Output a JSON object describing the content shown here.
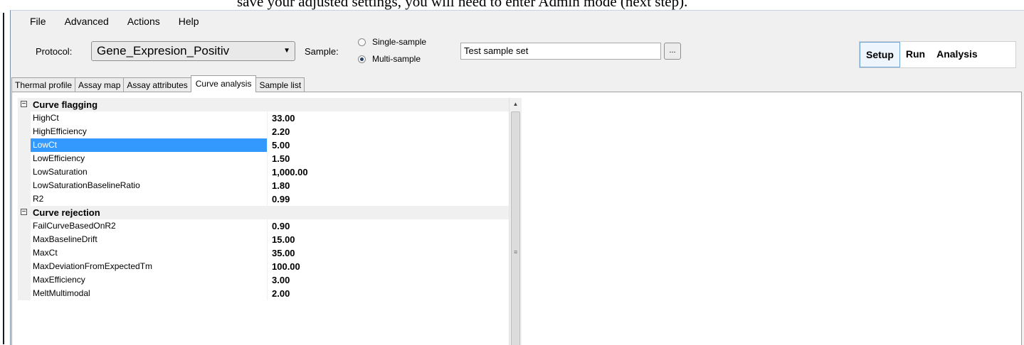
{
  "document_text": "save your adjusted settings, you will need to enter Admin mode (next step).",
  "menu": [
    "File",
    "Advanced",
    "Actions",
    "Help"
  ],
  "toolbar": {
    "protocol_label": "Protocol:",
    "protocol_value": "Gene_Expresion_Positiv",
    "sample_label": "Sample:",
    "sample_options": [
      "Single-sample",
      "Multi-sample"
    ],
    "sample_selected": "Multi-sample",
    "sample_set_value": "Test sample set",
    "browse_label": "..."
  },
  "modes": [
    "Setup",
    "Run",
    "Analysis"
  ],
  "active_mode": "Setup",
  "tabs": [
    "Thermal profile",
    "Assay map",
    "Assay attributes",
    "Curve analysis",
    "Sample list"
  ],
  "active_tab": "Curve analysis",
  "property_grid": {
    "sections": [
      {
        "name": "Curve flagging",
        "expander": "−",
        "properties": [
          {
            "name": "HighCt",
            "value": "33.00"
          },
          {
            "name": "HighEfficiency",
            "value": "2.20"
          },
          {
            "name": "LowCt",
            "value": "5.00"
          },
          {
            "name": "LowEfficiency",
            "value": "1.50"
          },
          {
            "name": "LowSaturation",
            "value": "1,000.00"
          },
          {
            "name": "LowSaturationBaselineRatio",
            "value": "1.80"
          },
          {
            "name": "R2",
            "value": "0.99"
          }
        ]
      },
      {
        "name": "Curve rejection",
        "expander": "−",
        "properties": [
          {
            "name": "FailCurveBasedOnR2",
            "value": "0.90"
          },
          {
            "name": "MaxBaselineDrift",
            "value": "15.00"
          },
          {
            "name": "MaxCt",
            "value": "35.00"
          },
          {
            "name": "MaxDeviationFromExpectedTm",
            "value": "100.00"
          },
          {
            "name": "MaxEfficiency",
            "value": "3.00"
          },
          {
            "name": "MeltMultimodal",
            "value": "2.00"
          }
        ]
      }
    ],
    "selected_property": "LowCt"
  },
  "colors": {
    "selection": "#3399ff",
    "window_bg": "#f0f0f0",
    "active_mode_border": "#6fa3d6"
  }
}
